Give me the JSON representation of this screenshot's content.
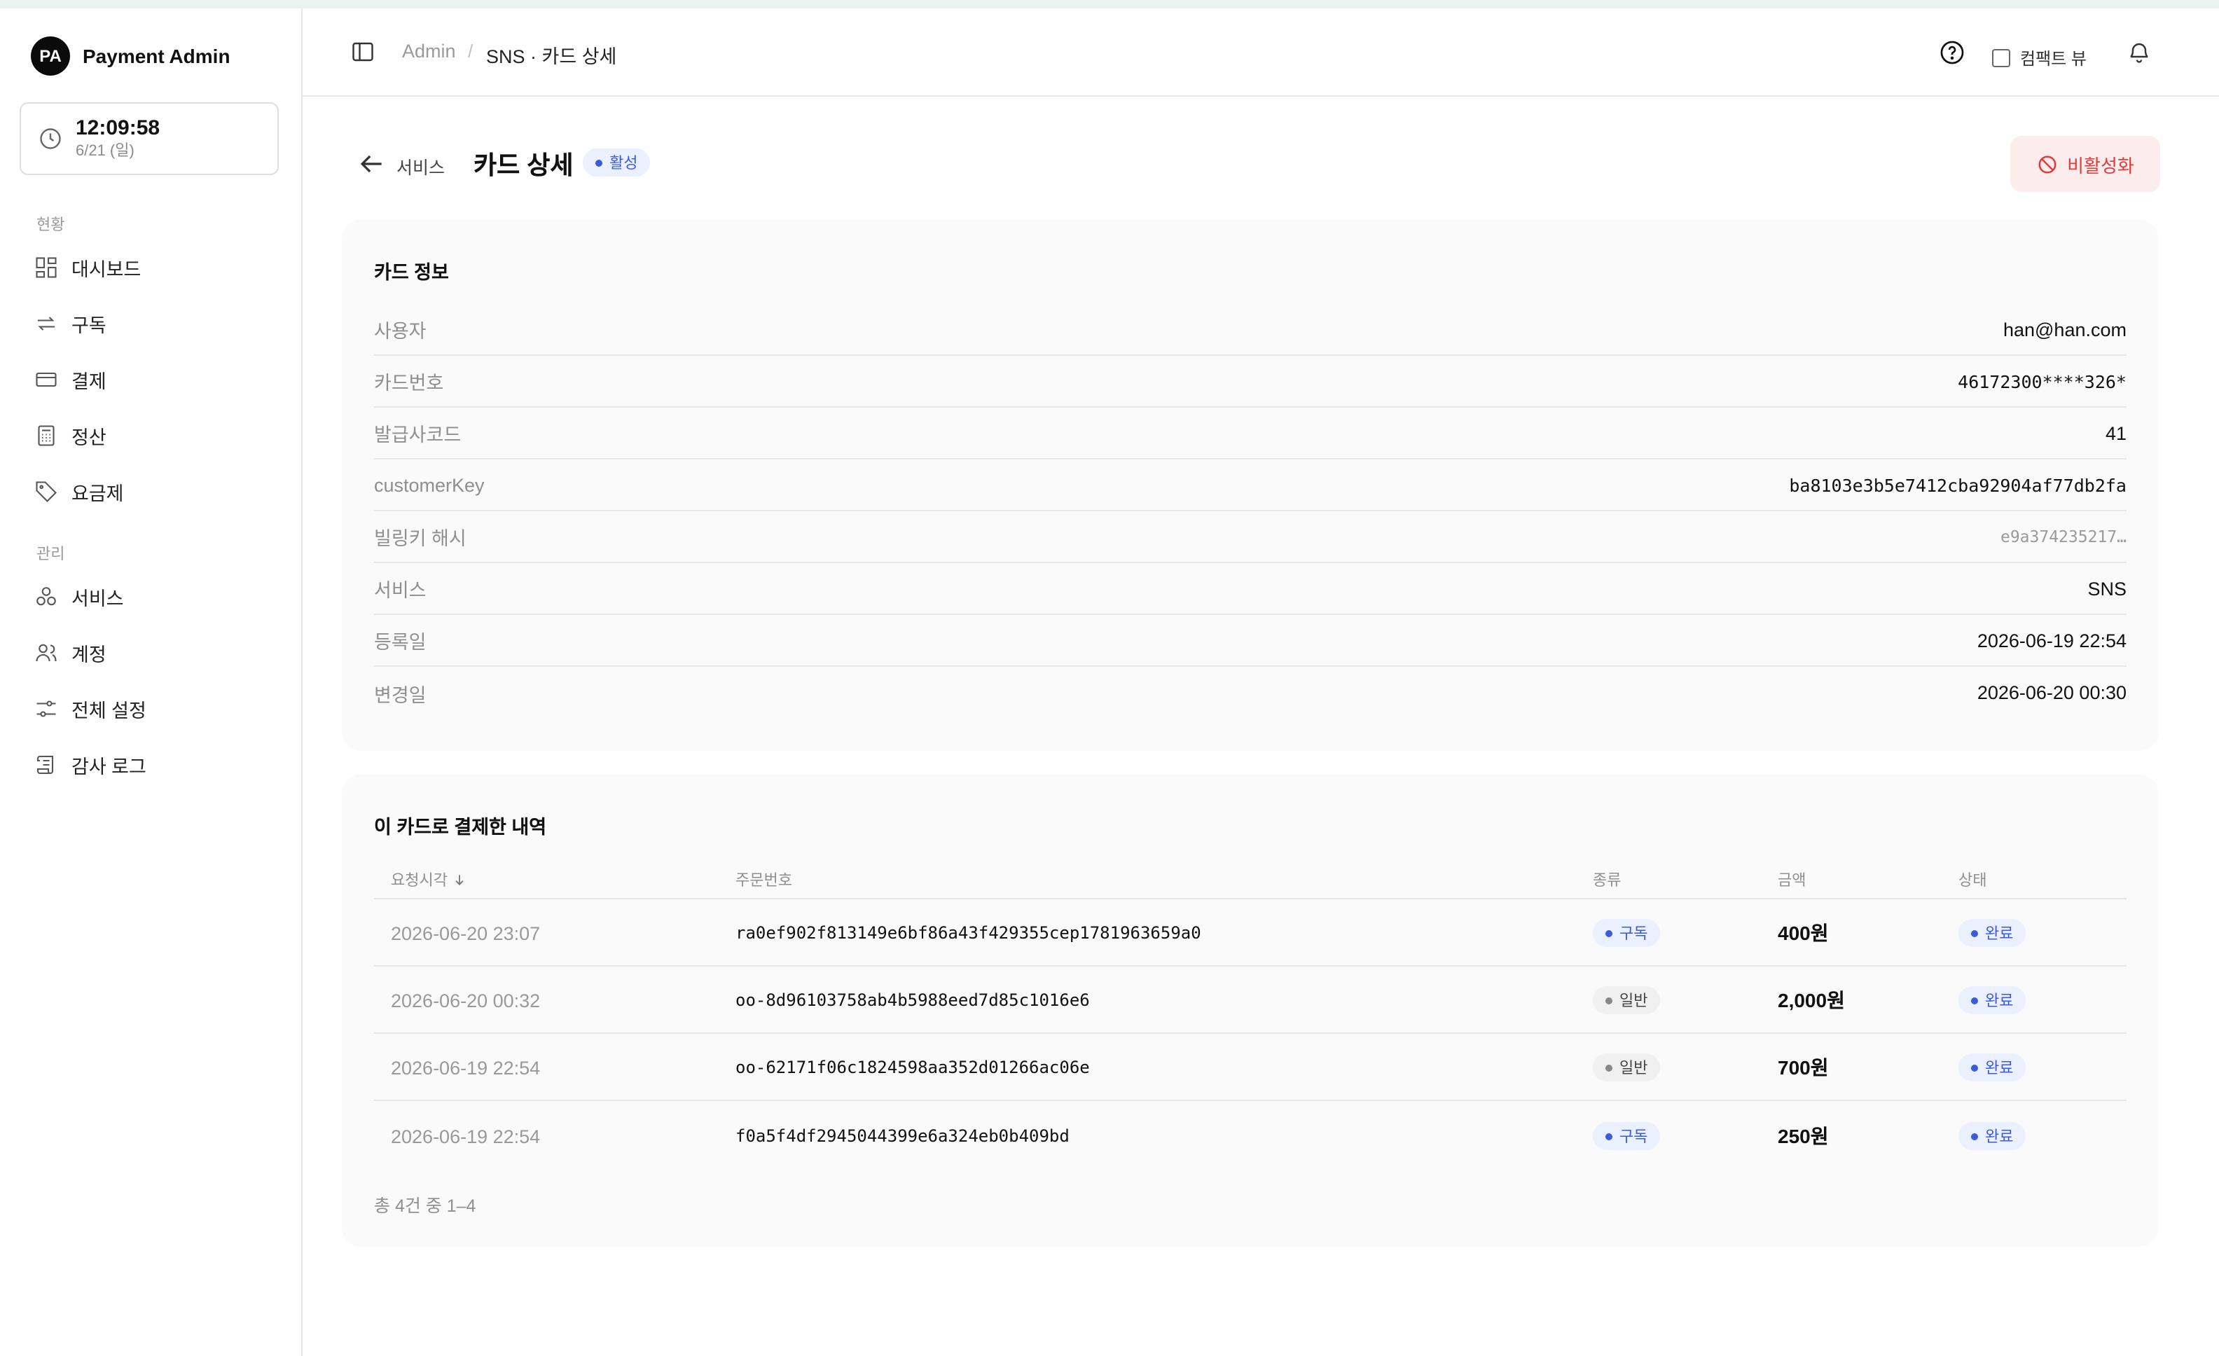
{
  "app": {
    "logo_initials": "PA",
    "name": "Payment Admin"
  },
  "clock": {
    "time": "12:09:58",
    "date": "6/21 (일)"
  },
  "sidebar": {
    "section_status": "현황",
    "section_manage": "관리",
    "items": [
      {
        "label": "대시보드",
        "icon": "dashboard-icon"
      },
      {
        "label": "구독",
        "icon": "repeat-icon"
      },
      {
        "label": "결제",
        "icon": "credit-card-icon"
      },
      {
        "label": "정산",
        "icon": "calculator-icon"
      },
      {
        "label": "요금제",
        "icon": "tag-icon"
      },
      {
        "label": "서비스",
        "icon": "boxes-icon"
      },
      {
        "label": "계정",
        "icon": "users-icon"
      },
      {
        "label": "전체 설정",
        "icon": "sliders-icon"
      },
      {
        "label": "감사 로그",
        "icon": "scroll-icon"
      }
    ]
  },
  "header": {
    "breadcrumb_root": "Admin",
    "breadcrumb_sep": "/",
    "breadcrumb_current": "SNS · 카드 상세",
    "compact_label": "컴팩트 뷰"
  },
  "page": {
    "back_label": "서비스",
    "title": "카드 상세",
    "status": "활성",
    "deactivate_label": "비활성화"
  },
  "card_info": {
    "title": "카드 정보",
    "rows": [
      {
        "label": "사용자",
        "value": "han@han.com"
      },
      {
        "label": "카드번호",
        "value": "46172300****326*"
      },
      {
        "label": "발급사코드",
        "value": "41"
      },
      {
        "label": "customerKey",
        "value": "ba8103e3b5e7412cba92904af77db2fa"
      },
      {
        "label": "빌링키 해시",
        "value": "e9a374235217…"
      },
      {
        "label": "서비스",
        "value": "SNS"
      },
      {
        "label": "등록일",
        "value": "2026-06-19 22:54"
      },
      {
        "label": "변경일",
        "value": "2026-06-20 00:30"
      }
    ]
  },
  "payments": {
    "title": "이 카드로 결제한 내역",
    "columns": {
      "time": "요청시각",
      "order": "주문번호",
      "type": "종류",
      "amount": "금액",
      "status": "상태"
    },
    "rows": [
      {
        "time": "2026-06-20 23:07",
        "order": "ra0ef902f813149e6bf86a43f429355cep1781963659a0",
        "type": "구독",
        "amount": "400원",
        "status": "완료"
      },
      {
        "time": "2026-06-20 00:32",
        "order": "oo-8d96103758ab4b5988eed7d85c1016e6",
        "type": "일반",
        "amount": "2,000원",
        "status": "완료"
      },
      {
        "time": "2026-06-19 22:54",
        "order": "oo-62171f06c1824598aa352d01266ac06e",
        "type": "일반",
        "amount": "700원",
        "status": "완료"
      },
      {
        "time": "2026-06-19 22:54",
        "order": "f0a5f4df2945044399e6a324eb0b409bd",
        "type": "구독",
        "amount": "250원",
        "status": "완료"
      }
    ],
    "footer": "총 4건 중 1–4"
  },
  "colors": {
    "accent_blue": "#3b5bdb",
    "danger": "#e03b3b",
    "danger_bg": "#fdecec"
  }
}
